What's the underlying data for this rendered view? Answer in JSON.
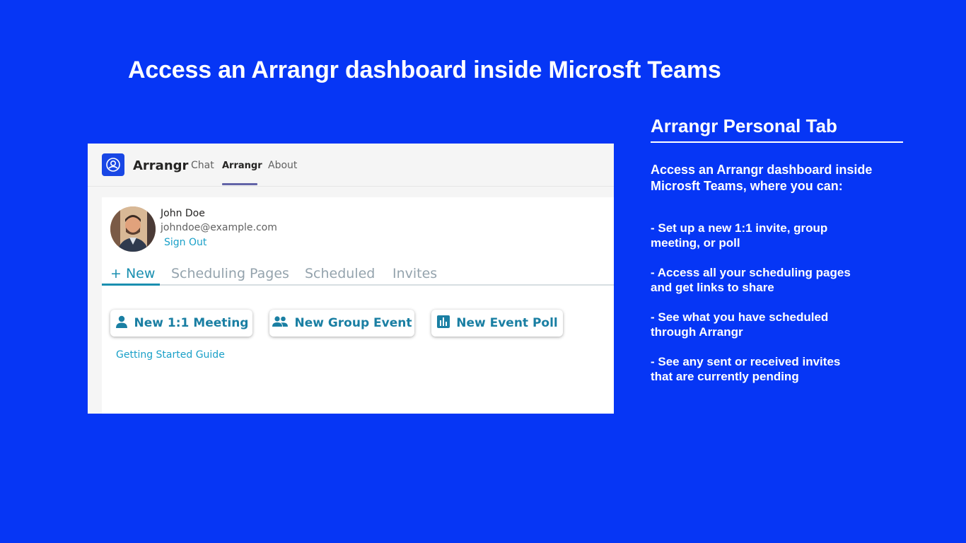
{
  "headline": "Access an Arrangr dashboard inside Microsft Teams",
  "teams": {
    "app_name": "Arrangr",
    "tabs": [
      {
        "label": "Chat",
        "active": false
      },
      {
        "label": "Arrangr",
        "active": true
      },
      {
        "label": "About",
        "active": false
      }
    ],
    "accent_color": "#6264a7"
  },
  "profile": {
    "name": "John Doe",
    "email": "johndoe@example.com",
    "sign_out": "Sign Out"
  },
  "app_tabs": [
    {
      "label": "+ New",
      "active": true
    },
    {
      "label": "Scheduling Pages",
      "active": false
    },
    {
      "label": "Scheduled",
      "active": false
    },
    {
      "label": "Invites",
      "active": false
    }
  ],
  "actions": [
    {
      "label": "New 1:1 Meeting",
      "icon": "person-icon"
    },
    {
      "label": "New Group Event",
      "icon": "group-icon"
    },
    {
      "label": "New Event Poll",
      "icon": "poll-icon"
    }
  ],
  "guide_link": "Getting Started Guide",
  "panel": {
    "title": "Arrangr Personal Tab",
    "intro": "Access an Arrangr dashboard inside Microsft Teams, where you can:",
    "bullets": [
      "- Set up a new 1:1 invite, group meeting, or poll",
      "- Access all your scheduling pages and get links to share",
      "- See what you have scheduled through Arrangr",
      "- See any sent or received invites that are currently pending"
    ]
  },
  "colors": {
    "background": "#0636f5",
    "brand": "#1947e5",
    "app_accent": "#1a8fb0",
    "link": "#1aa0c8"
  }
}
